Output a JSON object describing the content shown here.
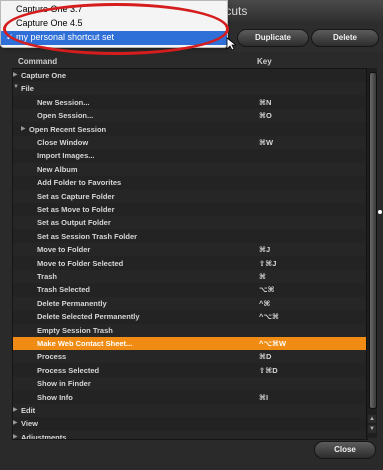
{
  "window": {
    "title": "rtcuts"
  },
  "toolbar": {
    "duplicate_label": "Duplicate",
    "delete_label": "Delete"
  },
  "header": {
    "command": "Command",
    "key": "Key"
  },
  "menu": {
    "items": [
      {
        "label": "Capture One 3.7",
        "checked": false,
        "selected": false
      },
      {
        "label": "Capture One 4.5",
        "checked": false,
        "selected": false
      },
      {
        "label": "my personal shortcut set",
        "checked": true,
        "selected": true
      }
    ],
    "check_mark": "✓"
  },
  "list": {
    "rows": [
      {
        "label": "Capture One",
        "key": "",
        "indent": 1,
        "arrow": "▶",
        "selected": false
      },
      {
        "label": "File",
        "key": "",
        "indent": 1,
        "arrow": "▼",
        "selected": false
      },
      {
        "label": "New Session...",
        "key": "⌘N",
        "indent": 3,
        "arrow": "",
        "selected": false
      },
      {
        "label": "Open Session...",
        "key": "⌘O",
        "indent": 3,
        "arrow": "",
        "selected": false
      },
      {
        "label": "Open Recent Session",
        "key": "",
        "indent": 2,
        "arrow": "▶",
        "selected": false
      },
      {
        "label": "Close Window",
        "key": "⌘W",
        "indent": 3,
        "arrow": "",
        "selected": false
      },
      {
        "label": "Import Images...",
        "key": "",
        "indent": 3,
        "arrow": "",
        "selected": false
      },
      {
        "label": "New Album",
        "key": "",
        "indent": 3,
        "arrow": "",
        "selected": false
      },
      {
        "label": "Add Folder to Favorites",
        "key": "",
        "indent": 3,
        "arrow": "",
        "selected": false
      },
      {
        "label": "Set as Capture Folder",
        "key": "",
        "indent": 3,
        "arrow": "",
        "selected": false
      },
      {
        "label": "Set as Move to Folder",
        "key": "",
        "indent": 3,
        "arrow": "",
        "selected": false
      },
      {
        "label": "Set as Output Folder",
        "key": "",
        "indent": 3,
        "arrow": "",
        "selected": false
      },
      {
        "label": "Set as Session Trash Folder",
        "key": "",
        "indent": 3,
        "arrow": "",
        "selected": false
      },
      {
        "label": "Move to Folder",
        "key": "⌘J",
        "indent": 3,
        "arrow": "",
        "selected": false
      },
      {
        "label": "Move to Folder Selected",
        "key": "⇧⌘J",
        "indent": 3,
        "arrow": "",
        "selected": false
      },
      {
        "label": "Trash",
        "key": "⌘",
        "indent": 3,
        "arrow": "",
        "selected": false
      },
      {
        "label": "Trash Selected",
        "key": "⌥⌘",
        "indent": 3,
        "arrow": "",
        "selected": false
      },
      {
        "label": "Delete Permanently",
        "key": "^⌘",
        "indent": 3,
        "arrow": "",
        "selected": false
      },
      {
        "label": "Delete Selected Permanently",
        "key": "^⌥⌘",
        "indent": 3,
        "arrow": "",
        "selected": false
      },
      {
        "label": "Empty Session Trash",
        "key": "",
        "indent": 3,
        "arrow": "",
        "selected": false
      },
      {
        "label": "Make Web Contact Sheet...",
        "key": "^⌥⌘W",
        "indent": 3,
        "arrow": "",
        "selected": true
      },
      {
        "label": "Process",
        "key": "⌘D",
        "indent": 3,
        "arrow": "",
        "selected": false
      },
      {
        "label": "Process Selected",
        "key": "⇧⌘D",
        "indent": 3,
        "arrow": "",
        "selected": false
      },
      {
        "label": "Show in Finder",
        "key": "",
        "indent": 3,
        "arrow": "",
        "selected": false
      },
      {
        "label": "Show Info",
        "key": "⌘I",
        "indent": 3,
        "arrow": "",
        "selected": false
      },
      {
        "label": "Edit",
        "key": "",
        "indent": 1,
        "arrow": "▶",
        "selected": false
      },
      {
        "label": "View",
        "key": "",
        "indent": 1,
        "arrow": "▶",
        "selected": false
      },
      {
        "label": "Adjustments",
        "key": "",
        "indent": 1,
        "arrow": "▶",
        "selected": false
      }
    ]
  },
  "footer": {
    "close_label": "Close"
  },
  "scroll": {
    "up_arrow": "▲",
    "down_arrow": "▼"
  },
  "colors": {
    "selection": "#f08c13",
    "highlight_circle": "#d51d1d",
    "menu_selection": "#2e6fd8"
  }
}
